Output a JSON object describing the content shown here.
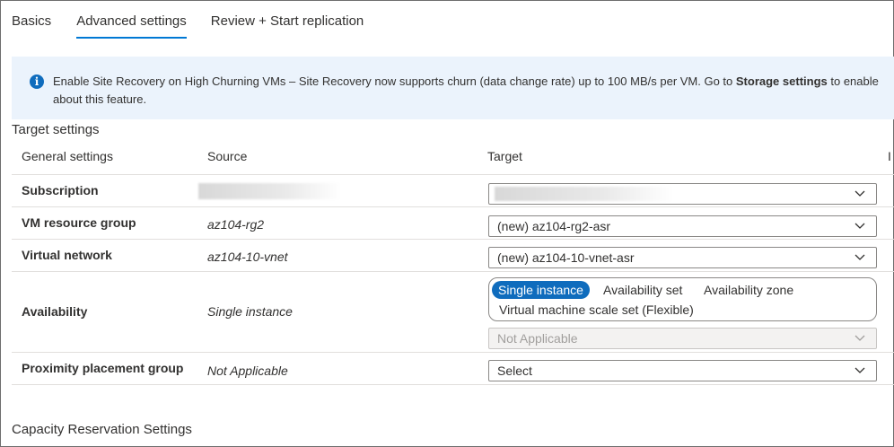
{
  "tabs": [
    {
      "label": "Basics",
      "selected": false
    },
    {
      "label": "Advanced settings",
      "selected": true
    },
    {
      "label": "Review + Start replication",
      "selected": false
    }
  ],
  "banner": {
    "icon": "info-icon",
    "text_segments": [
      "Enable Site Recovery on High Churning VMs – Site Recovery now supports churn (data change rate) up to 100 MB/s per VM. Go to ",
      "Storage settings",
      " to enable",
      "about this feature."
    ]
  },
  "target_settings": {
    "title": "Target settings",
    "columns": {
      "general": "General settings",
      "source": "Source",
      "target": "Target",
      "extra": "I"
    },
    "rows": {
      "subscription": {
        "label": "Subscription",
        "source": "",
        "target": ""
      },
      "resource_group": {
        "label": "VM resource group",
        "source": "az104-rg2",
        "target": "(new) az104-rg2-asr"
      },
      "virtual_network": {
        "label": "Virtual network",
        "source": "az104-10-vnet",
        "target": "(new) az104-10-vnet-asr"
      },
      "availability": {
        "label": "Availability",
        "source": "Single instance",
        "options": [
          "Single instance",
          "Availability set",
          "Availability zone",
          "Virtual machine scale set (Flexible)"
        ],
        "selected": "Single instance",
        "secondary_target": "Not Applicable"
      },
      "proximity": {
        "label": "Proximity placement group",
        "source": "Not Applicable",
        "target": "Select"
      }
    }
  },
  "capacity_reservation": {
    "title": "Capacity Reservation Settings"
  },
  "colors": {
    "accent": "#0078d4",
    "selected_pill": "#0f6cbd",
    "banner_bg": "#ebf3fc",
    "divider": "#e1dfdd"
  }
}
